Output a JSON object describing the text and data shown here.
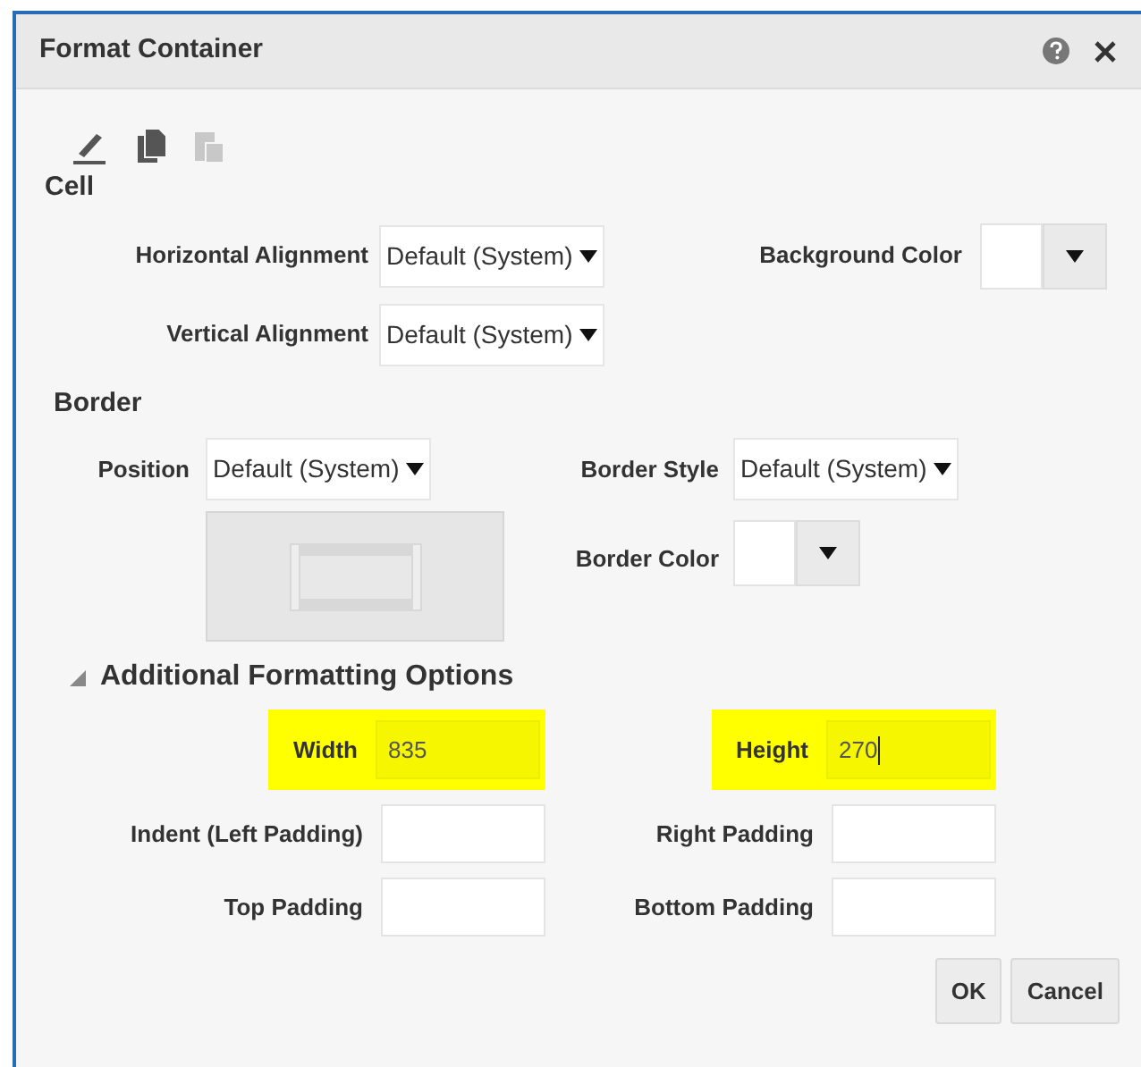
{
  "dialog": {
    "title": "Format Container"
  },
  "toolbar": [
    {
      "disabled": false
    },
    {
      "disabled": false
    },
    {
      "disabled": true
    }
  ],
  "cell": {
    "heading": "Cell",
    "horizontal_alignment": {
      "label": "Horizontal Alignment",
      "value": "Default (System)"
    },
    "vertical_alignment": {
      "label": "Vertical Alignment",
      "value": "Default (System)"
    },
    "background_color": {
      "label": "Background Color"
    }
  },
  "border": {
    "heading": "Border",
    "position": {
      "label": "Position",
      "value": "Default (System)"
    },
    "border_style": {
      "label": "Border Style",
      "value": "Default (System)"
    },
    "border_color": {
      "label": "Border Color"
    }
  },
  "additional": {
    "heading": "Additional Formatting Options",
    "expanded": true,
    "fields": [
      {
        "label": "Width",
        "value": "835",
        "highlighted": true,
        "focused": false
      },
      {
        "label": "Height",
        "value": "270",
        "highlighted": true,
        "focused": true
      },
      {
        "label": "Indent (Left Padding)",
        "highlighted": false,
        "focused": false
      },
      {
        "label": "Right Padding",
        "highlighted": false,
        "focused": false
      },
      {
        "label": "Top Padding",
        "highlighted": false,
        "focused": false
      },
      {
        "label": "Bottom Padding",
        "highlighted": false,
        "focused": false
      }
    ]
  },
  "buttons": [
    "OK",
    "Cancel"
  ]
}
